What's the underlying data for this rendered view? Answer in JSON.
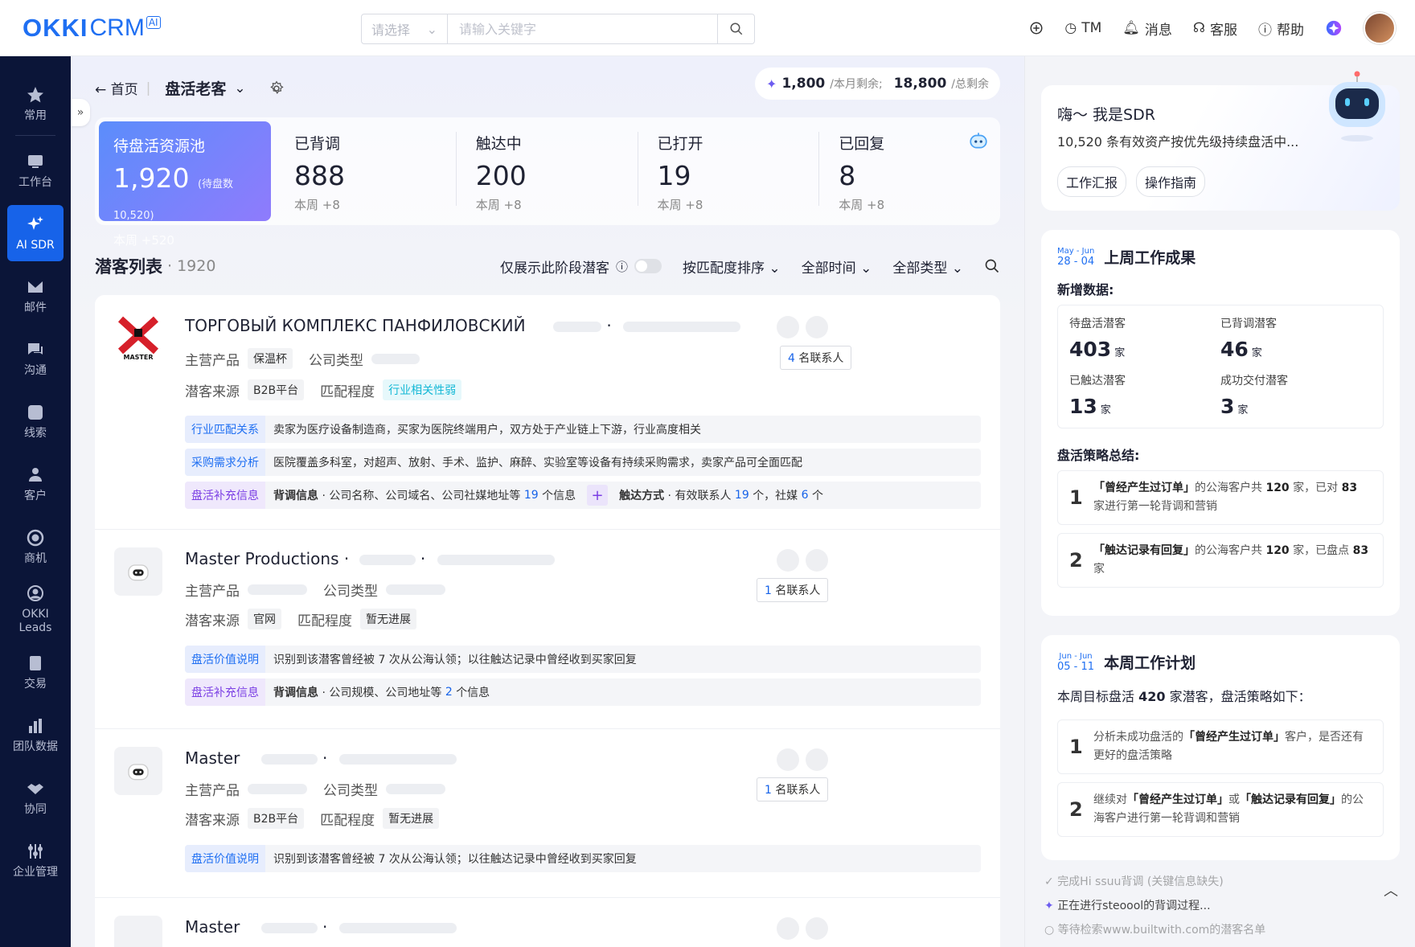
{
  "header": {
    "logo": "OKKI",
    "logo_crm": "CRM",
    "logo_ai": "AI",
    "search": {
      "select_placeholder": "请选择",
      "input_placeholder": "请输入关键字"
    },
    "tools": {
      "tm": "TM",
      "messages": "消息",
      "service": "客服",
      "help": "帮助"
    }
  },
  "sidebar": {
    "items": [
      {
        "label": "常用",
        "icon": "star-icon"
      },
      {
        "label": "工作台",
        "icon": "workbench-icon"
      },
      {
        "label": "AI SDR",
        "icon": "sparkle-icon",
        "active": true
      },
      {
        "label": "邮件",
        "icon": "mail-icon"
      },
      {
        "label": "沟通",
        "icon": "chat-icon"
      },
      {
        "label": "线索",
        "icon": "leads-icon"
      },
      {
        "label": "客户",
        "icon": "customers-icon"
      },
      {
        "label": "商机",
        "icon": "opportunity-icon"
      },
      {
        "label": "OKKI Leads",
        "icon": "okki-leads-icon"
      },
      {
        "label": "交易",
        "icon": "deal-icon"
      },
      {
        "label": "团队数据",
        "icon": "team-data-icon"
      },
      {
        "label": "协同",
        "icon": "handshake-icon"
      },
      {
        "label": "企业管理",
        "icon": "settings-sliders-icon"
      }
    ]
  },
  "breadcrumb": {
    "home": "首页",
    "title": "盘活老客"
  },
  "quota": {
    "monthly": "1,800",
    "monthly_label": "/本月剩余;",
    "total": "18,800",
    "total_label": "/总剩余"
  },
  "stats": {
    "pool": {
      "label": "待盘活资源池",
      "value": "1,920",
      "sub": "(待盘数 10,520)",
      "week": "本周 +520"
    },
    "items": [
      {
        "label": "已背调",
        "value": "888",
        "week": "本周 +8"
      },
      {
        "label": "触达中",
        "value": "200",
        "week": "本周 +8"
      },
      {
        "label": "已打开",
        "value": "19",
        "week": "本周 +8"
      },
      {
        "label": "已回复",
        "value": "8",
        "week": "本周 +8"
      }
    ]
  },
  "list": {
    "title": "潜客列表",
    "count": "· 1920",
    "filters": {
      "only_stage": "仅展示此阶段潜客",
      "sort": "按匹配度排序",
      "time": "全部时间",
      "type": "全部类型"
    },
    "labels": {
      "product": "主营产品",
      "company_type": "公司类型",
      "source": "潜客来源",
      "match": "匹配程度"
    },
    "cards": [
      {
        "name": "ТОРГОВЫЙ КОМПЛЕКС ПАНФИЛОВСКИЙ",
        "product": "保温杯",
        "source": "B2B平台",
        "match": "行业相关性弱",
        "contacts_n": "4",
        "contacts_label": "名联系人",
        "insights": [
          {
            "k": "行业匹配关系",
            "t": "卖家为医疗设备制造商，买家为医院终端用户，双方处于产业链上下游，行业高度相关"
          },
          {
            "k": "采购需求分析",
            "t": "医院覆盖多科室，对超声、放射、手术、监护、麻醉、实验室等设备有持续采购需求，卖家产品可全面匹配"
          }
        ],
        "supp": {
          "k": "盘活补充信息",
          "a": "背调信息",
          "a_t": "· 公司名称、公司域名、公司社媒地址等",
          "a_n": "19",
          "a_u": "个信息",
          "b": "触达方式",
          "b_t": "· 有效联系人",
          "b_n": "19",
          "b_u": "个，社媒",
          "b_n2": "6",
          "b_u2": "个"
        }
      },
      {
        "name": "Master Productions",
        "source": "官网",
        "match": "暂无进展",
        "contacts_n": "1",
        "contacts_label": "名联系人",
        "value": {
          "k": "盘活价值说明",
          "t": "识别到该潜客曾经被 7 次从公海认领；以往触达记录中曾经收到买家回复"
        },
        "supp": {
          "k": "盘活补充信息",
          "a": "背调信息",
          "a_t": "· 公司规模、公司地址等",
          "a_n": "2",
          "a_u": "个信息"
        }
      },
      {
        "name": "Master",
        "source": "B2B平台",
        "match": "暂无进展",
        "contacts_n": "1",
        "contacts_label": "名联系人",
        "value": {
          "k": "盘活价值说明",
          "t": "识别到该潜客曾经被 7 次从公海认领；以往触达记录中曾经收到买家回复"
        }
      },
      {
        "name": "Master"
      }
    ]
  },
  "right": {
    "sdr": {
      "hello": "嗨～ 我是SDR",
      "desc": "10,520 条有效资产按优先级持续盘活中...",
      "btn1": "工作汇报",
      "btn2": "操作指南"
    },
    "last": {
      "m1": "May",
      "d1": "28",
      "m2": "Jun",
      "d2": "04",
      "title": "上周工作成果",
      "new_data": "新增数据:",
      "grid": [
        {
          "l": "待盘活潜客",
          "v": "403",
          "u": "家"
        },
        {
          "l": "已背调潜客",
          "v": "46",
          "u": "家"
        },
        {
          "l": "已触达潜客",
          "v": "13",
          "u": "家"
        },
        {
          "l": "成功交付潜客",
          "v": "3",
          "u": "家"
        }
      ],
      "summary": "盘活策略总结:",
      "s1": {
        "n": "1",
        "b": "「曾经产生过订单」",
        "t1": "的公海客户共",
        "n1": "120",
        "t2": "家，已对",
        "n2": "83",
        "t3": "家进行第一轮背调和营销"
      },
      "s2": {
        "n": "2",
        "b": "「触达记录有回复」",
        "t1": "的公海客户共",
        "n1": "120",
        "t2": "家，已盘点",
        "n2": "83",
        "t3": "家"
      }
    },
    "plan": {
      "m1": "Jun",
      "d1": "05",
      "m2": "Jun",
      "d2": "11",
      "title": "本周工作计划",
      "target": "本周目标盘活",
      "target_n": "420",
      "target_t": "家潜客，盘活策略如下：",
      "p1": {
        "n": "1",
        "t1": "分析未成功盘活的",
        "b": "「曾经产生过订单」",
        "t2": "客户，是否还有更好的盘活策略"
      },
      "p2": {
        "n": "2",
        "t1": "继续对",
        "b": "「曾经产生过订单」",
        "t2": "或",
        "b2": "「触达记录有回复」",
        "t3": "的公海客户进行第一轮背调和营销"
      }
    },
    "log": {
      "l1": "完成Hi ssuu背调 (关键信息缺失)",
      "l2": "正在进行steoool的背调过程...",
      "l3": "等待检索www.builtwith.com的潜客名单"
    }
  }
}
